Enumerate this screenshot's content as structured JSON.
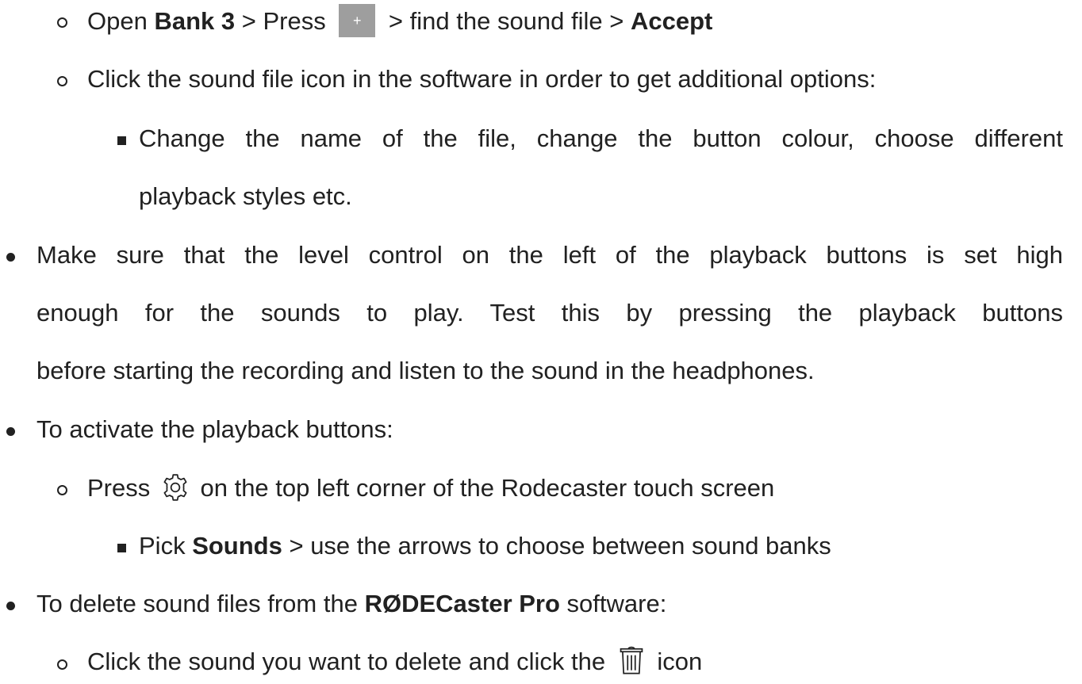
{
  "lines": {
    "l1": {
      "p1": "Open ",
      "b1": "Bank 3",
      "p2": " > Press ",
      "plus": "+",
      "p3": " > find the sound file > ",
      "b2": "Accept"
    },
    "l2": "Click the sound file icon in the software in order to get additional options:",
    "l3a": "Change the name of the file, change the button colour, choose different",
    "l3b": "playback styles etc.",
    "l4a": "Make sure that the level control on the left of the playback buttons is set high",
    "l4b": "enough for the sounds to play. Test this by pressing the playback buttons",
    "l4c": "before starting the recording and listen to the sound in the headphones.",
    "l5": "To activate the playback buttons:",
    "l6": {
      "p1": "Press",
      "p2": " on the top left corner of the Rodecaster touch screen"
    },
    "l7": {
      "p1": "Pick ",
      "b1": "Sounds",
      "p2": " > use the arrows to choose between sound banks"
    },
    "l8": {
      "p1": "To delete sound files from the ",
      "b1": "RØDECaster Pro",
      "p2": " software:"
    },
    "l9": {
      "p1": "Click the sound you want to delete and click the",
      "p2": " icon"
    }
  },
  "icons": {
    "plus_button": "plus-button",
    "settings": "gear-icon",
    "delete": "trash-icon"
  },
  "colors": {
    "text": "#212121",
    "plus_button_bg": "#9e9e9e"
  }
}
